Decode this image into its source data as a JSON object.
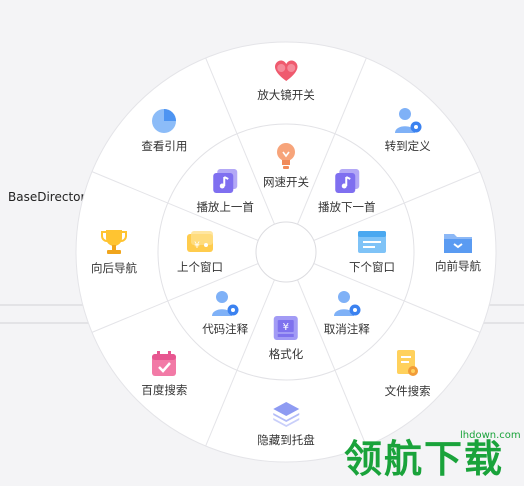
{
  "side_label": "BaseDirectory",
  "watermark": {
    "brand": "领航下载",
    "url": "lhdown.com"
  },
  "outer_ring": [
    {
      "label": "放大镜开关",
      "icon": "heart-glasses-icon"
    },
    {
      "label": "转到定义",
      "icon": "user-gear-icon"
    },
    {
      "label": "向前导航",
      "icon": "folder-icon"
    },
    {
      "label": "文件搜索",
      "icon": "document-search-icon"
    },
    {
      "label": "隐藏到托盘",
      "icon": "layers-icon"
    },
    {
      "label": "百度搜索",
      "icon": "calendar-check-icon"
    },
    {
      "label": "向后导航",
      "icon": "trophy-icon"
    },
    {
      "label": "查看引用",
      "icon": "pie-chart-icon"
    }
  ],
  "inner_ring": [
    {
      "label": "网速开关",
      "icon": "bulb-icon"
    },
    {
      "label": "播放下一首",
      "icon": "music-note-icon"
    },
    {
      "label": "下个窗口",
      "icon": "window-icon"
    },
    {
      "label": "取消注释",
      "icon": "user-gear-icon"
    },
    {
      "label": "格式化",
      "icon": "yen-box-icon"
    },
    {
      "label": "代码注释",
      "icon": "user-gear-icon"
    },
    {
      "label": "上个窗口",
      "icon": "ticket-icon"
    },
    {
      "label": "播放上一首",
      "icon": "music-note-icon"
    }
  ]
}
